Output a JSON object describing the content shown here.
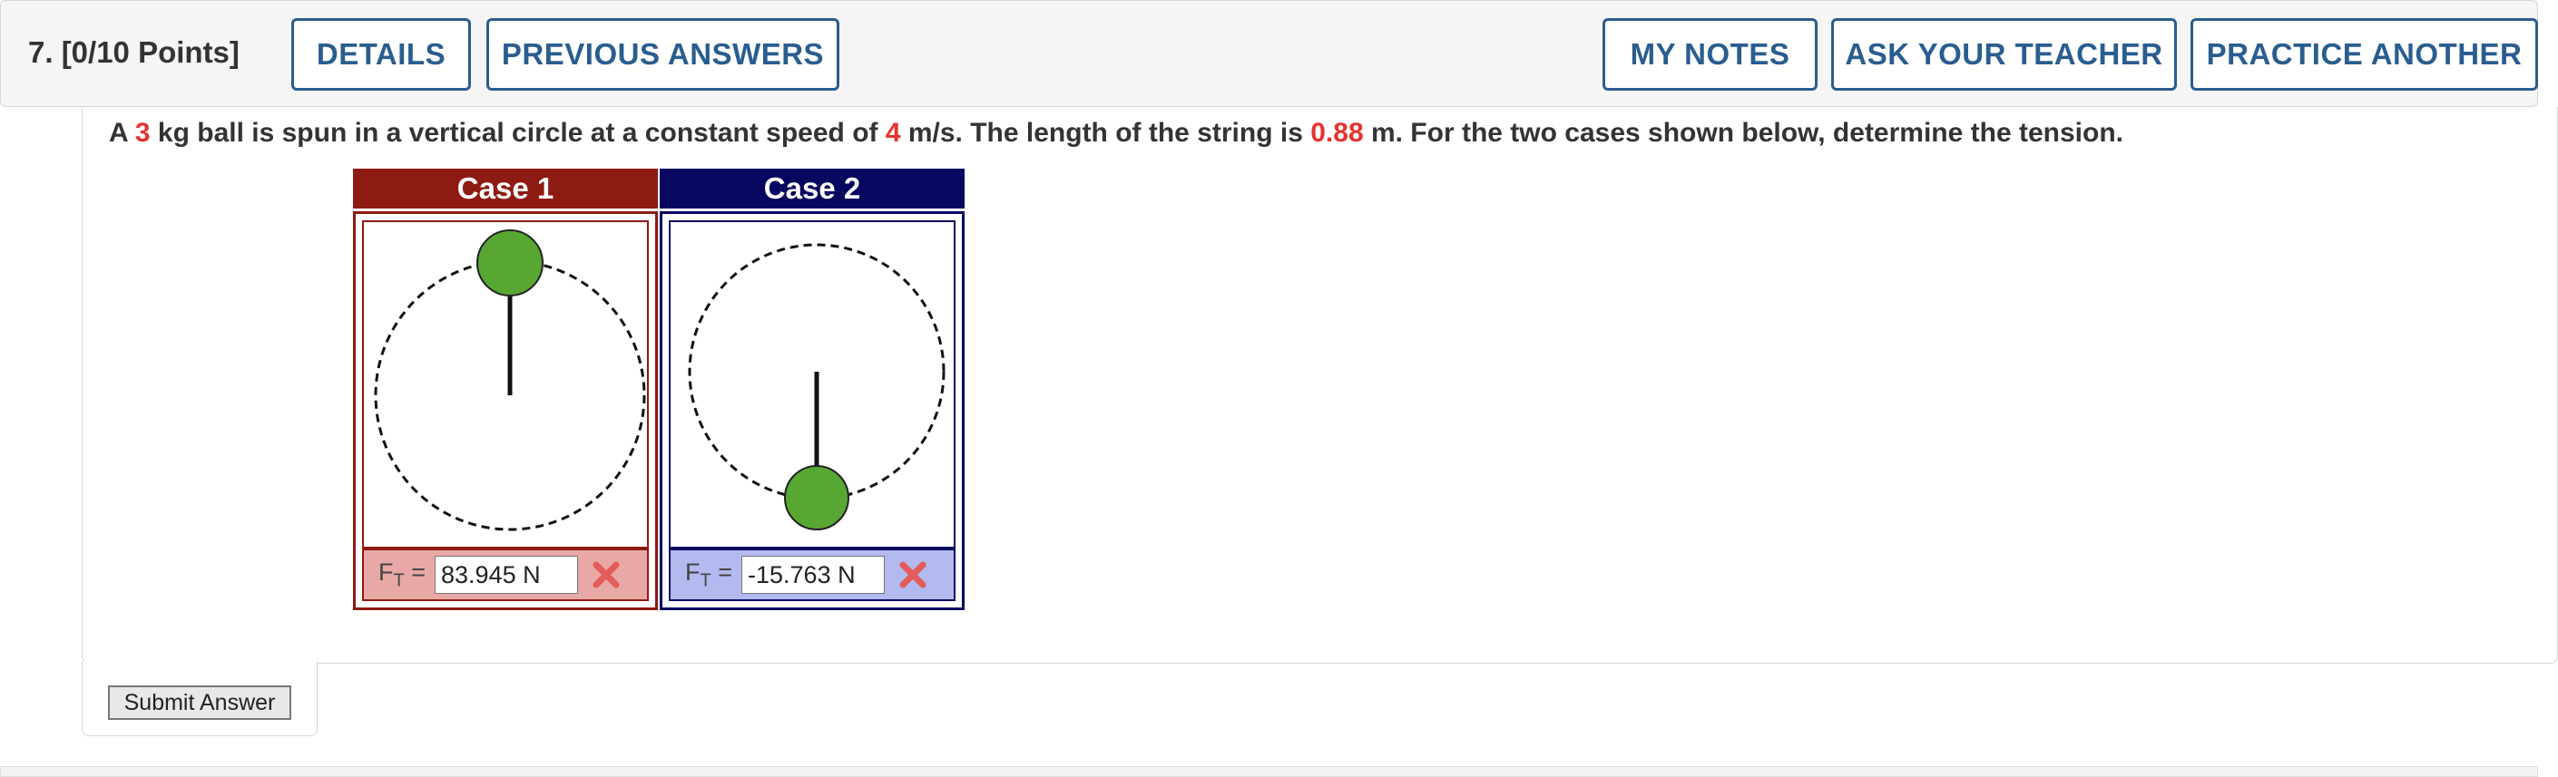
{
  "header": {
    "question_label": "7.  [0/10 Points]",
    "buttons": {
      "details": "DETAILS",
      "previous_answers": "PREVIOUS ANSWERS",
      "my_notes": "MY NOTES",
      "ask_teacher": "ASK YOUR TEACHER",
      "practice_another": "PRACTICE ANOTHER"
    }
  },
  "question": {
    "part1": "A ",
    "mass": "3",
    "part2": " kg ball is spun in a vertical circle at a constant speed of ",
    "speed": "4",
    "part3": " m/s. The length of the string is ",
    "length": "0.88",
    "part4": " m. For the two cases shown below, determine the tension."
  },
  "cases": [
    {
      "title": "Case 1",
      "label_main": "F",
      "label_sub": "T",
      "equals": "=",
      "answer_value": "83.945 N",
      "ball_position": "top",
      "header_color": "#8e1b13",
      "input_bg": "#e8a9a6",
      "result_icon": "incorrect-x-icon"
    },
    {
      "title": "Case 2",
      "label_main": "F",
      "label_sub": "T",
      "equals": "=",
      "answer_value": "-15.763 N",
      "ball_position": "bottom",
      "header_color": "#07075f",
      "input_bg": "#b3baf0",
      "result_icon": "incorrect-x-icon"
    }
  ],
  "colors": {
    "accent_blue": "#2a5d8f",
    "highlight_red": "#e3342f",
    "ball_green": "#58a733"
  },
  "submit": {
    "label": "Submit Answer"
  }
}
